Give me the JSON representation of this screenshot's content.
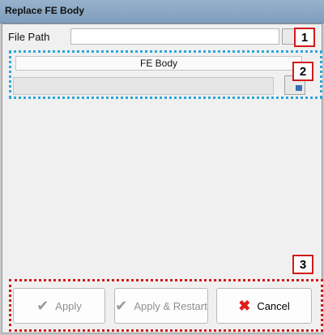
{
  "window": {
    "title": "Replace FE Body"
  },
  "form": {
    "file_path_label": "File Path",
    "file_path_value": "",
    "fe_body_label": "FE Body",
    "fe_body_value": ""
  },
  "callouts": [
    "1",
    "2",
    "3"
  ],
  "buttons": {
    "apply": "Apply",
    "apply_restart": "Apply & Restart",
    "cancel": "Cancel"
  },
  "icons": {
    "apply": "check-icon",
    "apply_restart": "check-arrow-icon",
    "cancel": "close-icon"
  },
  "colors": {
    "title_bar": "#8aa6c4",
    "callout_border": "#d11a1a",
    "highlight_dotted_blue": "#2aa7d8",
    "cancel_x": "#e11d1d"
  }
}
